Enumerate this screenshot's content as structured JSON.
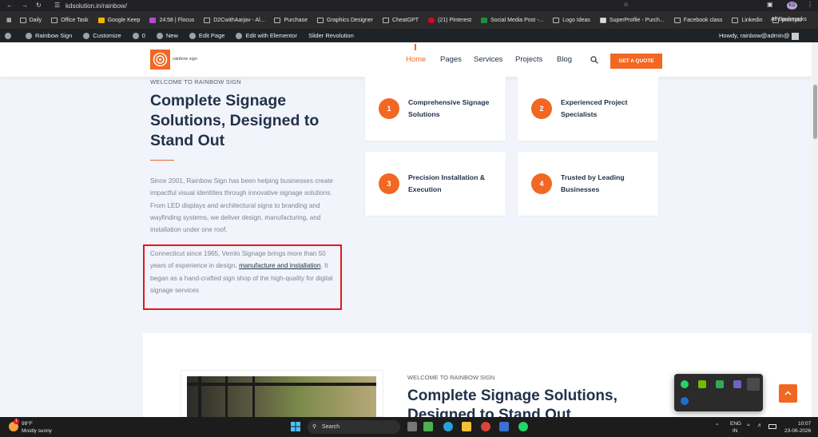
{
  "browser": {
    "url": "kdsolution.in/rainbow/",
    "bookmarks": [
      "Daily",
      "Office Task",
      "Google Keep",
      "24:58 | Flocus",
      "D2CwithAarjav - Al...",
      "Purchase",
      "Graphics Designer",
      "CheatGPT",
      "(21) Pinterest",
      "Social Media Post -...",
      "Logo Ideas",
      "SuperProfile - Purch...",
      "Facebook class",
      "Linkedin",
      "prompts"
    ],
    "all_bookmarks": "All Bookmarks",
    "profile": "KD"
  },
  "wp_admin_bar": {
    "items": [
      "Rainbow Sign",
      "Customize",
      "0",
      "New",
      "Edit Page",
      "Edit with Elementor",
      "Slider Revolution"
    ],
    "howdy": "Howdy, rainbow@admin@"
  },
  "header": {
    "logo_text": "rainbow sign",
    "nav": [
      "Home",
      "Pages",
      "Services",
      "Projects",
      "Blog"
    ],
    "cta": "GET A QUOTE"
  },
  "hero": {
    "eyebrow": "WELCOME TO RAINBOW SIGN",
    "title": "Complete Signage Solutions, Designed to Stand Out",
    "paragraph": "Since 2001, Rainbow Sign has been helping businesses create impactful visual identities through innovative signage solutions. From LED displays and architectural signs to branding and wayfinding systems, we deliver design, manufacturing, and installation under one roof.",
    "highlight_before": "Connecticut since 1965, Vemlo Signage brings more than 50 years of experience in design, ",
    "highlight_link": "manufacture and installation",
    "highlight_after": ". It began as a hand-crafted sign shop of the high-quality for digital signage services"
  },
  "features": [
    {
      "num": "1",
      "label": "Comprehensive Signage Solutions"
    },
    {
      "num": "2",
      "label": "Experienced Project Specialists"
    },
    {
      "num": "3",
      "label": "Precision Installation & Execution"
    },
    {
      "num": "4",
      "label": "Trusted by Leading Businesses"
    }
  ],
  "section2": {
    "eyebrow": "WELCOME TO RAINBOW SIGN",
    "title": "Complete Signage Solutions, Designed to Stand Out"
  },
  "taskbar": {
    "weather_temp": "99°F",
    "weather_desc": "Mostly sunny",
    "weather_badge": "1",
    "search_placeholder": "Search",
    "lang_top": "ENG",
    "lang_bottom": "IN",
    "time": "10:07",
    "date": "23-06-2026"
  },
  "colors": {
    "accent": "#f26722",
    "heading": "#22324a",
    "body_text": "#7b8494",
    "highlight_border": "#e4161b",
    "page_bg": "#f1f4fa"
  }
}
